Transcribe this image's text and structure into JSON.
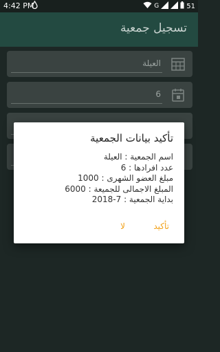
{
  "status_bar": {
    "time": "4:42 PM",
    "carrier_mark": "G",
    "battery": "51"
  },
  "app_bar": {
    "title": "تسجيل جمعية"
  },
  "form": {
    "rows": [
      {
        "value": "العيلة",
        "icon": "calendar-grid-icon"
      },
      {
        "value": "6",
        "icon": "calendar-icon"
      },
      {
        "value": "",
        "icon": ""
      },
      {
        "value": "",
        "icon": ""
      }
    ]
  },
  "dialog": {
    "title": "تأكيد بيانات الجمعية",
    "lines": [
      "اسم الجمعية : العيلة",
      "عدد افرادها : 6",
      "مبلغ العضو الشهرى : 1000",
      "المبلغ الاجمالى للجميعة : 6000",
      "بداية الجمعية : 7-2018"
    ],
    "confirm_label": "تأكيد",
    "cancel_label": "لا"
  },
  "colors": {
    "accent": "#f2a21a",
    "app_bar": "#234a41",
    "background": "#1d2725"
  }
}
